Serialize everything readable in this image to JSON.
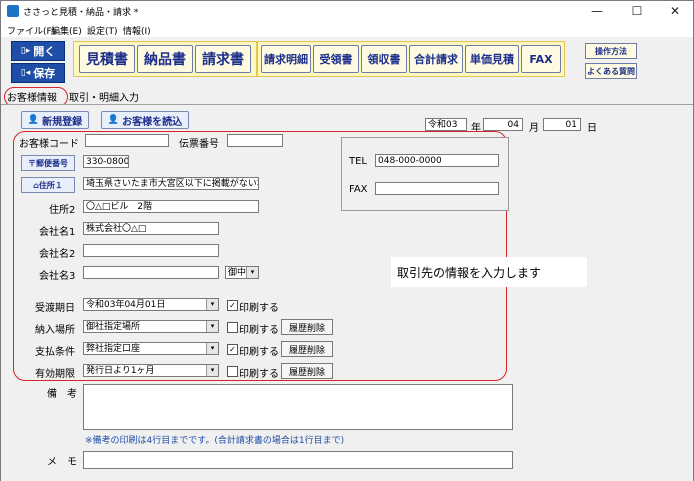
{
  "window": {
    "title": "ささっと見積・納品・請求 *",
    "min_glyph": "—",
    "max_glyph": "☐",
    "close_glyph": "✕"
  },
  "menu": [
    "ファイル(F)",
    "編集(E)",
    "設定(T)",
    "情報(I)"
  ],
  "toolbar": {
    "open_label": "開く",
    "save_label": "保存",
    "doc_buttons": [
      "見積書",
      "納品書",
      "請求書"
    ],
    "sub_buttons": [
      "請求明細",
      "受領書",
      "領収書",
      "合計請求",
      "単価見積",
      "FAX"
    ],
    "help_label": "操作方法",
    "faq_label": "よくある質問"
  },
  "tabs": [
    "お客様情報",
    "取引・明細入力"
  ],
  "actions": {
    "new_label": "新規登録",
    "load_label": "お客様を読込"
  },
  "date": {
    "era": "令和03",
    "nen": "年",
    "month": "04",
    "tsuki": "月",
    "day": "01",
    "nichi": "日"
  },
  "form": {
    "customer_code_label": "お客様コード",
    "customer_code_value": "",
    "slip_no_label": "伝票番号",
    "slip_no_value": "",
    "postal_btn": "郵便番号",
    "postal_value": "330-0800",
    "addr1_btn": "住所１",
    "addr1_value": "埼玉県さいたま市大宮区以下に掲載がない場",
    "addr2_label": "住所2",
    "addr2_value": "〇△□ビル　2階",
    "company1_label": "会社名1",
    "company1_value": "株式会社〇△□",
    "company2_label": "会社名2",
    "company2_value": "",
    "company3_label": "会社名3",
    "company3_value": "",
    "honorific_value": "御中",
    "tel_label": "TEL",
    "tel_value": "048-000-0000",
    "fax_label": "FAX",
    "fax_value": "",
    "delivery_date_label": "受渡期日",
    "delivery_date_value": "令和03年04月01日",
    "delivery_place_label": "納入場所",
    "delivery_place_value": "御社指定場所",
    "payment_label": "支払条件",
    "payment_value": "弊社指定口座",
    "validity_label": "有効期限",
    "validity_value": "発行日より1ヶ月",
    "print_label": "印刷する",
    "history_delete": "履歴削除",
    "remarks_label": "備　考",
    "remarks_note": "※備考の印刷は4行目までです。(合計請求書の場合は1行目まで)",
    "memo_label": "メ　モ"
  },
  "callout_text": "取引先の情報を入力します",
  "checks": {
    "delivery_date": true,
    "delivery_place": false,
    "payment": true,
    "validity": false
  },
  "colors": {
    "accent": "#1f4ea8",
    "highlight_red": "#d8232a",
    "button_bg": "#fffbe3"
  }
}
